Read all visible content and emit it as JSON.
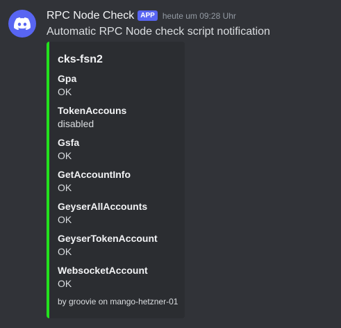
{
  "message": {
    "username": "RPC Node Check",
    "app_tag": "APP",
    "timestamp": "heute um 09:28 Uhr",
    "content": "Automatic RPC Node check script notification",
    "avatar_icon": "discord-logo-icon",
    "avatar_color": "#5865f2"
  },
  "embed": {
    "accent_color": "#23e11e",
    "title": "cks-fsn2",
    "fields": [
      {
        "name": "Gpa",
        "value": "OK"
      },
      {
        "name": "TokenAccouns",
        "value": "disabled"
      },
      {
        "name": "Gsfa",
        "value": "OK"
      },
      {
        "name": "GetAccountInfo",
        "value": "OK"
      },
      {
        "name": "GeyserAllAccounts",
        "value": "OK"
      },
      {
        "name": "GeyserTokenAccount",
        "value": "OK"
      },
      {
        "name": "WebsocketAccount",
        "value": "OK"
      }
    ],
    "footer": "by groovie on mango-hetzner-01"
  }
}
